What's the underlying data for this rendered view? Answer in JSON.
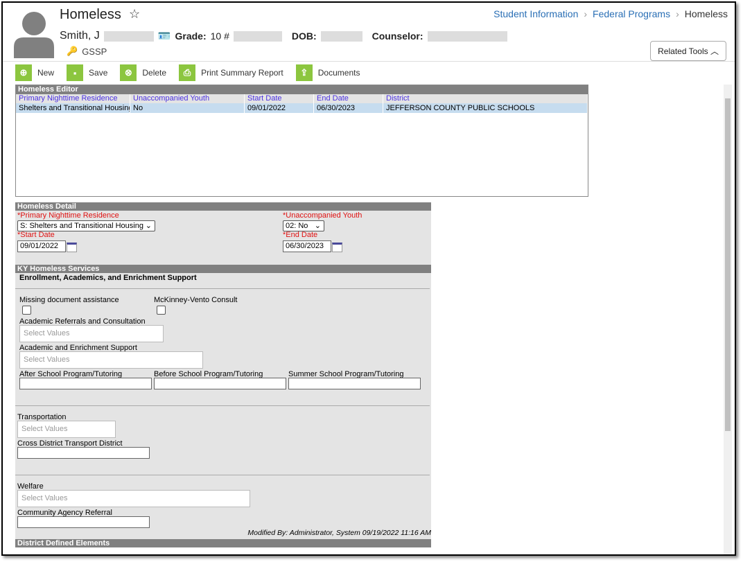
{
  "header": {
    "title": "Homeless",
    "student_name": "Smith, J",
    "grade_label": "Grade:",
    "grade_value": "10 #",
    "dob_label": "DOB:",
    "counselor_label": "Counselor:",
    "program": "GSSP"
  },
  "breadcrumb": [
    "Student Information",
    "Federal Programs",
    "Homeless"
  ],
  "related_tools": "Related Tools",
  "toolbar": [
    {
      "label": "New",
      "icon": "plus-circle-icon"
    },
    {
      "label": "Save",
      "icon": "save-icon"
    },
    {
      "label": "Delete",
      "icon": "x-circle-icon"
    },
    {
      "label": "Print Summary Report",
      "icon": "printer-icon"
    },
    {
      "label": "Documents",
      "icon": "upload-icon"
    }
  ],
  "editor": {
    "title": "Homeless Editor",
    "columns": [
      "Primary Nighttime Residence",
      "Unaccompanied Youth",
      "Start Date",
      "End Date",
      "District"
    ],
    "rows": [
      [
        "Shelters and Transitional Housing",
        "No",
        "09/01/2022",
        "06/30/2023",
        "JEFFERSON COUNTY PUBLIC SCHOOLS"
      ]
    ]
  },
  "detail": {
    "title": "Homeless Detail",
    "pnr_label": "*Primary Nighttime Residence",
    "pnr_value": "S: Shelters and Transitional Housing",
    "uy_label": "*Unaccompanied Youth",
    "uy_value": "02: No",
    "start_label": "*Start Date",
    "start_value": "09/01/2022",
    "end_label": "*End Date",
    "end_value": "06/30/2023"
  },
  "services": {
    "title": "KY Homeless Services",
    "subtitle": "Enrollment, Academics, and Enrichment Support",
    "missing_doc": "Missing document assistance",
    "mckinney": "McKinney-Vento Consult",
    "academic_ref": "Academic Referrals and Consultation",
    "academic_enrich": "Academic and Enrichment Support",
    "after_school": "After School Program/Tutoring",
    "before_school": "Before School Program/Tutoring",
    "summer_school": "Summer School Program/Tutoring",
    "transportation": "Transportation",
    "cross_district": "Cross District Transport District",
    "welfare": "Welfare",
    "community": "Community Agency Referral",
    "placeholder": "Select Values",
    "modified": "Modified By: Administrator, System 09/19/2022 11:16 AM"
  },
  "district_defined": "District Defined Elements",
  "colors": {
    "accent_green": "#8cc63f",
    "link_blue": "#2a6fb5",
    "header_gray": "#808080",
    "required_red": "#e01010",
    "selected_row": "#c6dcef"
  }
}
